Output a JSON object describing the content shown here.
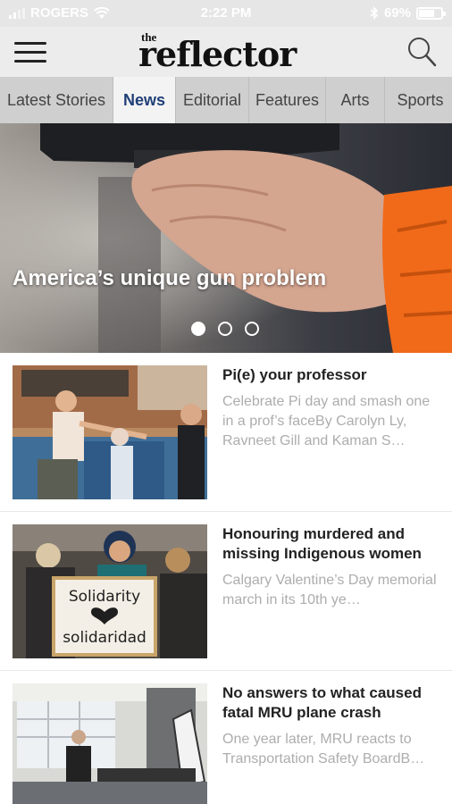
{
  "status_bar": {
    "carrier": "ROGERS",
    "time": "2:22 PM",
    "battery_percent": "69%",
    "battery_level": 0.69
  },
  "header": {
    "logo_small": "the",
    "logo_main": "reflector"
  },
  "tabs": [
    {
      "label": "Latest Stories",
      "active": false
    },
    {
      "label": "News",
      "active": true
    },
    {
      "label": "Editorial",
      "active": false
    },
    {
      "label": "Features",
      "active": false
    },
    {
      "label": "Arts",
      "active": false
    },
    {
      "label": "Sports",
      "active": false
    }
  ],
  "hero": {
    "title": "America’s unique gun problem",
    "slide_count": 3,
    "active_slide": 1
  },
  "articles": [
    {
      "title": "Pi(e) your professor",
      "summary": "Celebrate Pi day and smash one in a prof’s faceBy Carolyn Ly, Ravneet Gill and Kaman S…"
    },
    {
      "title": "Honouring murdered and missing Indigenous women",
      "summary": "Calgary Valentine’s Day memorial march in its 10th ye…",
      "sign_line1": "Solidarity",
      "sign_line2": "solidaridad"
    },
    {
      "title": "No answers to what caused fatal MRU plane crash",
      "summary": "One year later, MRU reacts to Transportation Safety BoardB…"
    }
  ],
  "colors": {
    "active_tab_text": "#1f3f77",
    "tab_bar": "#cfcfcf",
    "summary_text": "#adadad",
    "jacket_orange": "#f06a1a"
  }
}
